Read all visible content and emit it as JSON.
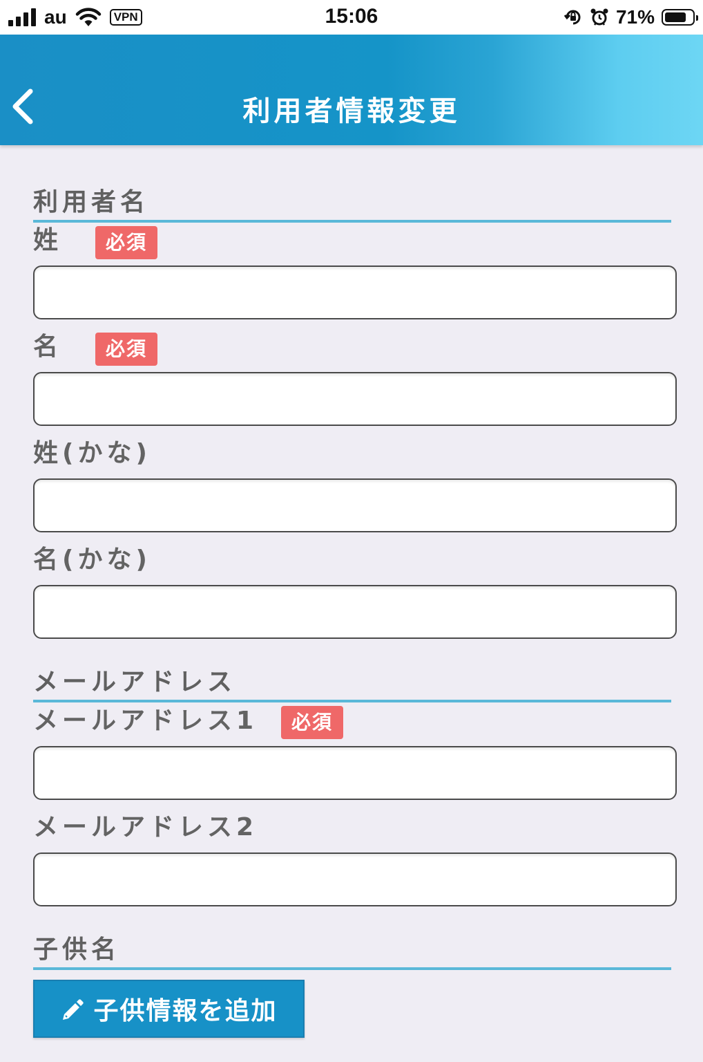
{
  "status_bar": {
    "carrier": "au",
    "vpn": "VPN",
    "time": "15:06",
    "battery": "71%"
  },
  "header": {
    "title": "利用者情報変更"
  },
  "sections": {
    "user_name": {
      "heading": "利用者名",
      "last_name_label": "姓",
      "first_name_label": "名",
      "last_name_kana_label": "姓(かな)",
      "first_name_kana_label": "名(かな)"
    },
    "email": {
      "heading": "メールアドレス",
      "email1_label": "メールアドレス1",
      "email2_label": "メールアドレス2"
    },
    "children": {
      "heading": "子供名",
      "add_button_label": "子供情報を追加"
    }
  },
  "required_badge": "必須",
  "colors": {
    "header_gradient_start": "#1a8fc6",
    "header_gradient_end": "#6dd6f4",
    "section_underline": "#5ab8d8",
    "required_badge": "#ef6868",
    "primary_button": "#1791c7",
    "background": "#efedf4"
  }
}
